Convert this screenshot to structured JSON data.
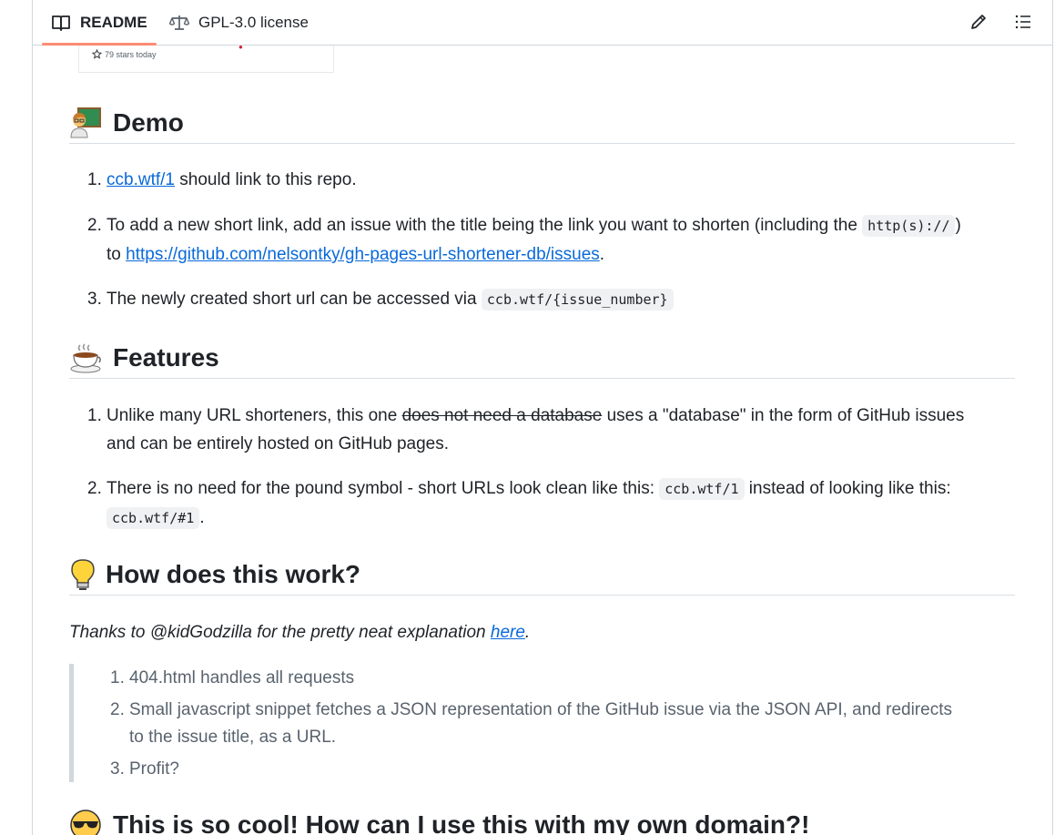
{
  "tabs": {
    "readme": "README",
    "license": "GPL-3.0 license"
  },
  "card": {
    "stars_today": "79 stars today"
  },
  "sections": {
    "demo": {
      "title": "Demo",
      "items": [
        {
          "num": "1.",
          "link": "ccb.wtf/1",
          "text": " should link to this repo."
        },
        {
          "num": "2.",
          "text_a": "To add a new short link, add an issue with the title being the link you want to shorten (including the ",
          "code": "http(s)://",
          "text_b": ")",
          "text_c": "to ",
          "link": "https://github.com/nelsontky/gh-pages-url-shortener-db/issues",
          "text_d": "."
        },
        {
          "num": "3.",
          "text": "The newly created short url can be accessed via ",
          "code": "ccb.wtf/{issue_number}"
        }
      ]
    },
    "features": {
      "title": "Features",
      "items": [
        {
          "num": "1.",
          "text_a": "Unlike many URL shorteners, this one ",
          "strike": "does not need a database",
          "text_b": " uses a \"database\" in the form of GitHub issues",
          "text_c": "and can be entirely hosted on GitHub pages."
        },
        {
          "num": "2.",
          "text_a": "There is no need for the pound symbol - short URLs look clean like this: ",
          "code_a": "ccb.wtf/1",
          "text_b": " instead of looking like this:",
          "code_b": "ccb.wtf/#1",
          "text_c": "."
        }
      ]
    },
    "how": {
      "title": "How does this work?",
      "intro": "Thanks to @kidGodzilla for the pretty neat explanation ",
      "intro_link": "here",
      "intro_end": ".",
      "quote_items": [
        {
          "num": "1.",
          "text": "404.html handles all requests"
        },
        {
          "num": "2.",
          "text": "Small javascript snippet fetches a JSON representation of the GitHub issue via the JSON API, and redirects",
          "text2": "to the issue title, as a URL."
        },
        {
          "num": "3.",
          "text": "Profit?"
        }
      ]
    },
    "cool": {
      "title": "This is so cool! How can I use this with my own domain?!"
    }
  },
  "icons": [
    "book-icon",
    "law-icon",
    "pencil-icon",
    "list-icon",
    "teacher-emoji",
    "coffee-emoji",
    "bulb-emoji",
    "sunglasses-emoji",
    "star-icon"
  ]
}
